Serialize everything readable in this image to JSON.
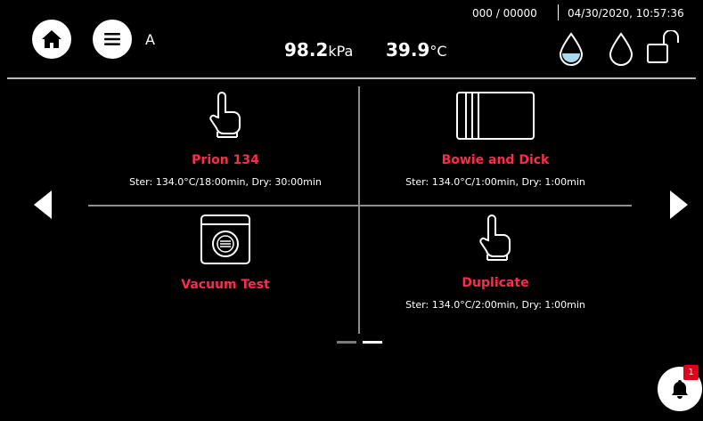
{
  "header": {
    "user": "A",
    "counter": "000 / 00000",
    "datetime": "04/30/2020, 10:57:36",
    "pressure_value": "98.2",
    "pressure_unit": "kPa",
    "temperature_value": "39.9",
    "temperature_unit": "°C",
    "icons": [
      "home-icon",
      "menu-icon",
      "water-drop-filled-icon",
      "water-drop-outline-icon",
      "unlock-icon"
    ]
  },
  "programs": [
    {
      "name": "Prion 134",
      "detail": "Ster: 134.0°C/18:00min, Dry: 30:00min",
      "icon": "hand-pointer-icon"
    },
    {
      "name": "Bowie and Dick",
      "detail": "Ster: 134.0°C/1:00min, Dry: 1:00min",
      "icon": "test-pack-icon"
    },
    {
      "name": "Vacuum Test",
      "detail": "",
      "icon": "vacuum-test-icon"
    },
    {
      "name": "Duplicate",
      "detail": "Ster: 134.0°C/2:00min, Dry: 1:00min",
      "icon": "hand-pointer-icon"
    }
  ],
  "pagination": {
    "pages": 2,
    "current": 2
  },
  "notifications": {
    "count": "1"
  },
  "colors": {
    "accent": "#ff2b4a",
    "background": "#000000",
    "drop_fill": "#a9d8f0",
    "badge": "#e0001b"
  }
}
